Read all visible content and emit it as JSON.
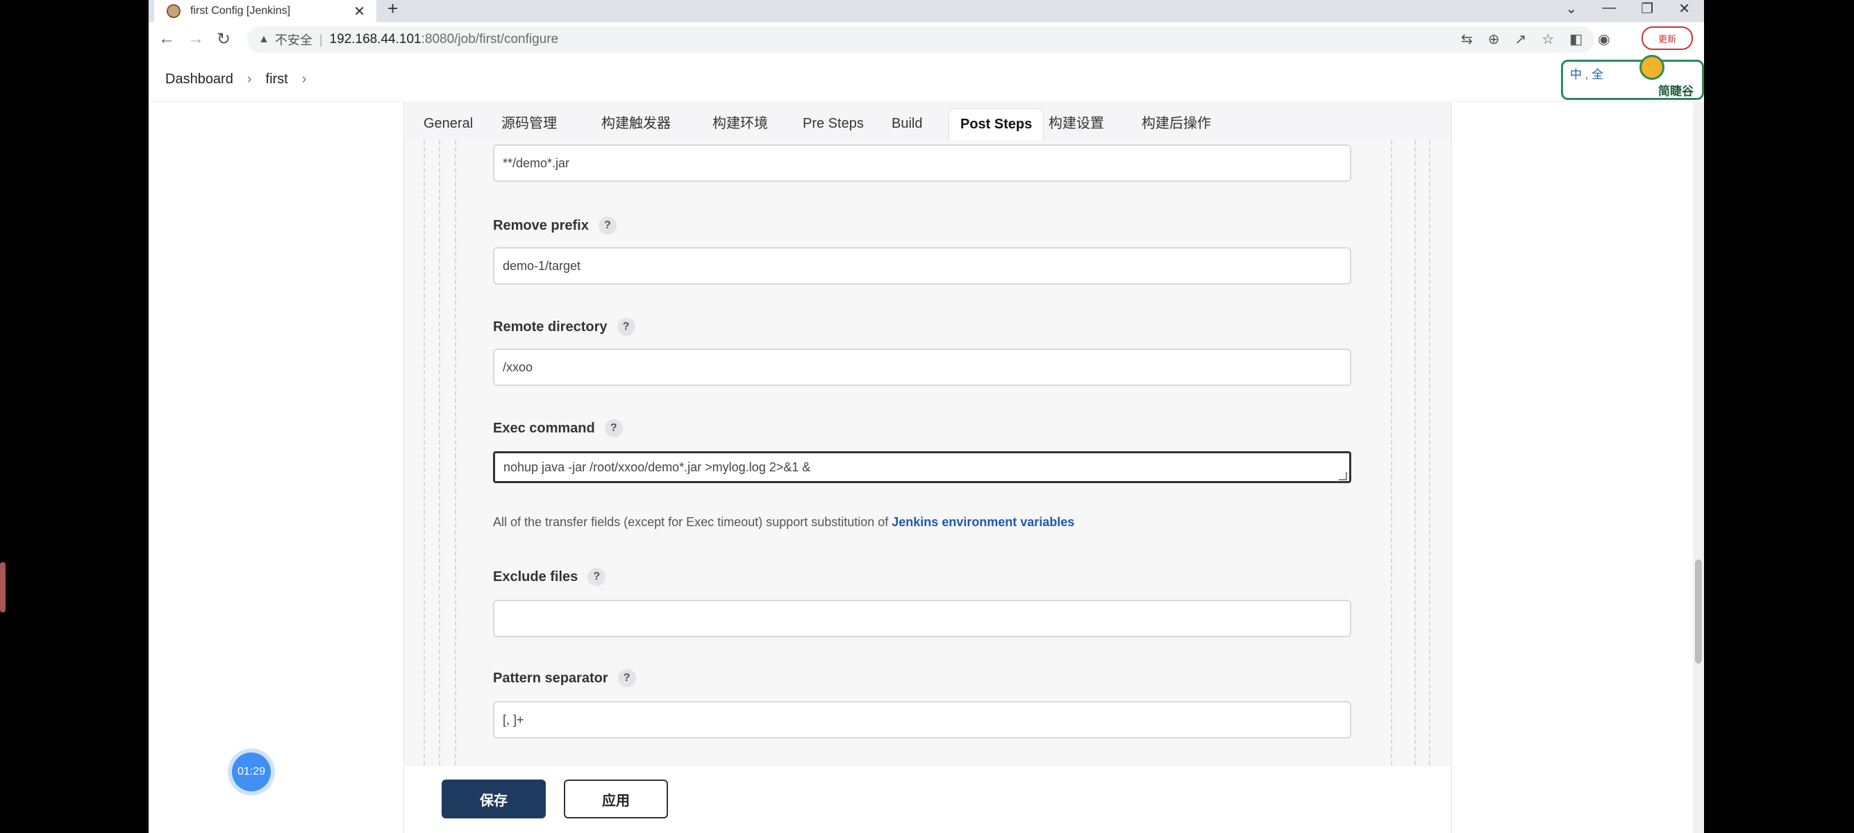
{
  "browser": {
    "tab_title": "first Config [Jenkins]",
    "tab_close": "✕",
    "new_tab": "+",
    "window_controls": [
      "⌄",
      "—",
      "❐",
      "✕"
    ],
    "nav": {
      "back": "←",
      "forward": "→",
      "reload": "↻"
    },
    "address": {
      "warning_icon": "▲",
      "insecure_label": "不安全",
      "host": "192.168.44.101",
      "path": ":8080/job/first/configure"
    },
    "toolbar_icons": [
      "translate-icon",
      "zoom-icon",
      "share-icon",
      "star-icon",
      "sidebar-icon",
      "profile-icon",
      "menu-icon"
    ],
    "update_label": "更新"
  },
  "breadcrumb": {
    "items": [
      "Dashboard",
      "first"
    ]
  },
  "config_tabs": [
    {
      "label": "General"
    },
    {
      "label": "源码管理"
    },
    {
      "label": "构建触发器"
    },
    {
      "label": "构建环境"
    },
    {
      "label": "Pre Steps"
    },
    {
      "label": "Build"
    },
    {
      "label": "Post Steps",
      "active": true
    },
    {
      "label": "构建设置"
    },
    {
      "label": "构建后操作"
    }
  ],
  "form": {
    "source_files_value": "**/demo*.jar",
    "remove_prefix": {
      "label": "Remove prefix",
      "value": "demo-1/target"
    },
    "remote_directory": {
      "label": "Remote directory",
      "value": "/xxoo"
    },
    "exec_command": {
      "label": "Exec command",
      "value": "nohup java -jar /root/xxoo/demo*.jar >mylog.log 2>&1 &"
    },
    "help_text": "All of the transfer fields (except for Exec timeout) support substitution of ",
    "help_link": "Jenkins environment variables",
    "exclude_files": {
      "label": "Exclude files",
      "value": ""
    },
    "pattern_separator": {
      "label": "Pattern separator",
      "value": "[, ]+"
    },
    "help_glyph": "?"
  },
  "actions": {
    "save": "保存",
    "apply": "应用"
  },
  "overlay": {
    "timer": "01:29",
    "ime_text": "中 , 全",
    "ime_brand": "简睫谷"
  }
}
